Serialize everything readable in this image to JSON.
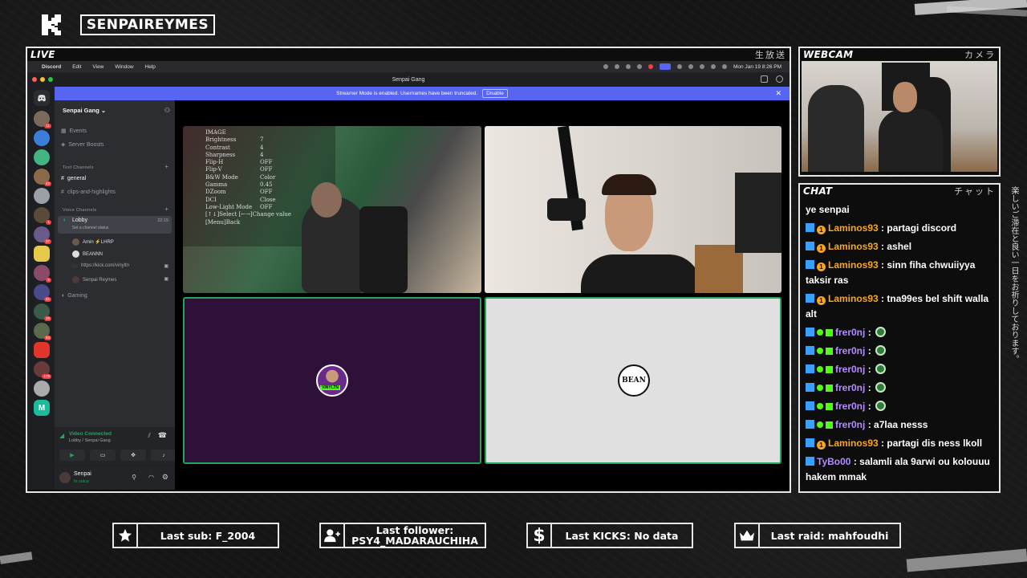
{
  "brand": {
    "name": "SENPAIREYMES"
  },
  "live_panel": {
    "title": "LIVE",
    "jp": "生放送"
  },
  "webcam_panel": {
    "title": "WEBCAM",
    "jp": "カメラ"
  },
  "chat_panel": {
    "title": "CHAT",
    "jp": "チャット"
  },
  "side_text": "楽しいご滞在と良い一日をお祈りしております。",
  "discord": {
    "menubar": {
      "app": "Discord",
      "items": [
        "Edit",
        "View",
        "Window",
        "Help"
      ],
      "clock": "Mon Jan 19  8:26 PM"
    },
    "window_title": "Senpai Gang",
    "banner": {
      "text": "Streamer Mode is enabled. Usernames have been truncated.",
      "button": "Disable"
    },
    "server_name": "Senpai Gang",
    "events_label": "Events",
    "boosts_label": "Server Boosts",
    "text_category": "Text Channels",
    "channels": [
      "general",
      "clips-and-highlights"
    ],
    "voice_category": "Voice Channels",
    "lobby": {
      "name": "Lobby",
      "timer": "22:15",
      "status": "Set a channel status"
    },
    "voice_users": [
      "Amin ⚡LHRP",
      "BEANNN",
      "https://kick.com/vinyltn",
      "Senpai Reymes"
    ],
    "gaming_channel": "Gaming",
    "voice_connected": {
      "title": "Video Connected",
      "subtitle": "Lobby / Senpai Gang"
    },
    "user": {
      "name": "Senpai",
      "status": "In voice"
    },
    "osd": {
      "title": "IMAGE",
      "rows": [
        [
          "Brightness",
          "7"
        ],
        [
          "Contrast",
          "4"
        ],
        [
          "Sharpness",
          "4"
        ],
        [
          "Flip-H",
          "OFF"
        ],
        [
          "Flip-V",
          "OFF"
        ],
        [
          "B&W Mode",
          "Color"
        ],
        [
          "Gamma",
          "0.45"
        ],
        [
          "DZoom",
          "OFF"
        ],
        [
          "DCI",
          "Close"
        ],
        [
          "Low-Light Mode",
          "OFF"
        ]
      ],
      "footer1": "[↑↓]Select [←→]Change value",
      "footer2": "[Menu]Back"
    },
    "tile3_label": "VINYLTN",
    "tile4_label": "BEAN"
  },
  "chat": [
    {
      "user": "",
      "text": "ye senpai",
      "color": "#ffffff",
      "badges": []
    },
    {
      "user": "Laminos93",
      "text": ": partagi discord",
      "color": "#f5a623",
      "badges": [
        "k",
        "1"
      ]
    },
    {
      "user": "Laminos93",
      "text": ": ashel",
      "color": "#f5a623",
      "badges": [
        "k",
        "1"
      ]
    },
    {
      "user": "Laminos93",
      "text": ": sinn fiha chwuiiyya",
      "text2": "taksir ras",
      "color": "#f5a623",
      "badges": [
        "k",
        "1"
      ]
    },
    {
      "user": "Laminos93",
      "text": ": tna99es bel shift walla",
      "text2": "alt",
      "color": "#f5a623",
      "badges": [
        "k",
        "1"
      ]
    },
    {
      "user": "frer0nj",
      "text": ":",
      "color": "#b48cff",
      "badges": [
        "k",
        "g",
        "s"
      ],
      "emote": true
    },
    {
      "user": "frer0nj",
      "text": ":",
      "color": "#b48cff",
      "badges": [
        "k",
        "g",
        "s"
      ],
      "emote": true
    },
    {
      "user": "frer0nj",
      "text": ":",
      "color": "#b48cff",
      "badges": [
        "k",
        "g",
        "s"
      ],
      "emote": true
    },
    {
      "user": "frer0nj",
      "text": ":",
      "color": "#b48cff",
      "badges": [
        "k",
        "g",
        "s"
      ],
      "emote": true
    },
    {
      "user": "frer0nj",
      "text": ":",
      "color": "#b48cff",
      "badges": [
        "k",
        "g",
        "s"
      ],
      "emote": true
    },
    {
      "user": "frer0nj",
      "text": ": a7laa nesss",
      "color": "#b48cff",
      "badges": [
        "k",
        "g",
        "s"
      ]
    },
    {
      "user": "Laminos93",
      "text": ": partagi dis ness lkoll",
      "color": "#f5a623",
      "badges": [
        "k",
        "1"
      ]
    },
    {
      "user": "TyBo00",
      "text": ": salamli ala 9arwi ou kolouuu",
      "text2": "hakem mmak",
      "color": "#b48cff",
      "badges": [
        "k"
      ]
    }
  ],
  "stats": {
    "last_sub": "Last sub: F_2004",
    "last_follower_line1": "Last follower:",
    "last_follower_line2": "PSY4_MADARAUCHIHA",
    "last_kicks": "Last KICKS: No data",
    "last_raid": "Last raid: mahfoudhi"
  },
  "colors": {
    "discord_blurple": "#5865f2",
    "discord_green": "#23a55a",
    "kick_green": "#53fc18",
    "tile_purple": "#2e1038",
    "tile_grey": "#e0e0e0"
  }
}
